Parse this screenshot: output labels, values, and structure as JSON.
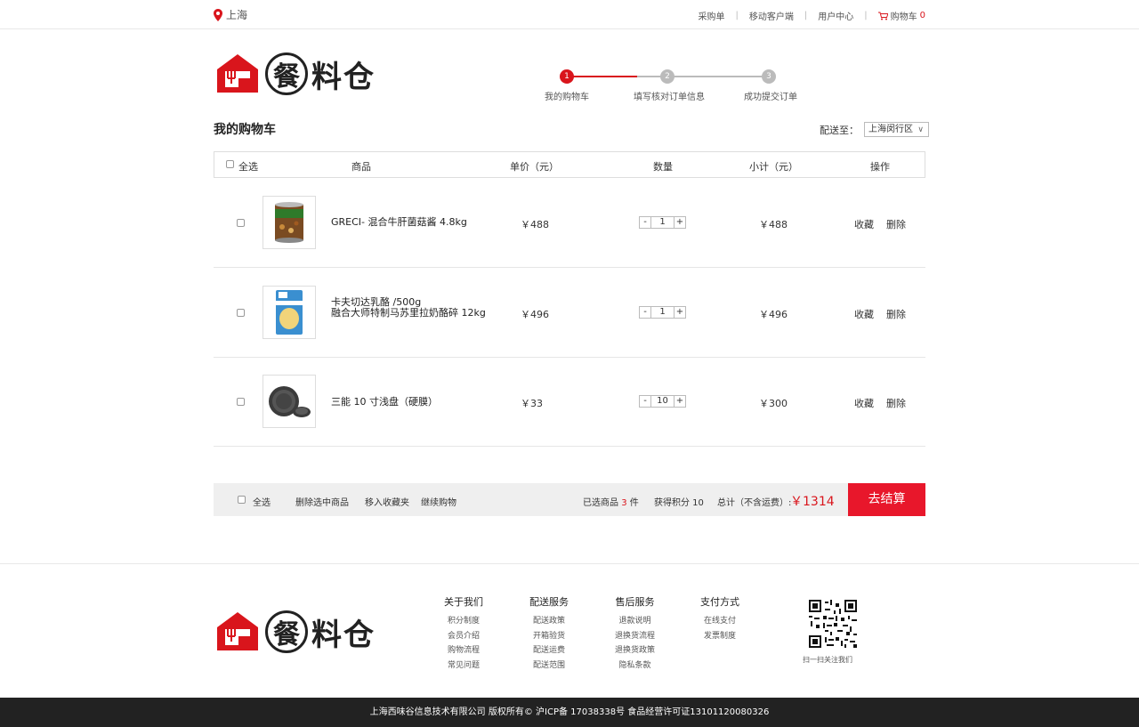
{
  "topbar": {
    "location": "上海",
    "links": [
      "采购单",
      "移动客户端",
      "用户中心"
    ],
    "cart_label": "购物车",
    "cart_count": "0"
  },
  "logo": {
    "char1": "餐",
    "rest": "料仓"
  },
  "steps": [
    {
      "num": "1",
      "label": "我的购物车"
    },
    {
      "num": "2",
      "label": "填写核对订单信息"
    },
    {
      "num": "3",
      "label": "成功提交订单"
    }
  ],
  "page_title": "我的购物车",
  "shipping": {
    "label": "配送至：",
    "value": "上海闵行区"
  },
  "table": {
    "headers": {
      "select_all": "全选",
      "product": "商品",
      "unit_price": "单价（元）",
      "quantity": "数量",
      "subtotal": "小计（元）",
      "actions": "操作"
    },
    "rows": [
      {
        "name1": "GRECI- 混合牛肝菌菇酱 4.8kg",
        "name2": "",
        "price": "￥488",
        "qty": "1",
        "subtotal": "￥488",
        "fav": "收藏",
        "del": "删除"
      },
      {
        "name1": "卡夫切达乳酪 /500g",
        "name2": "融合大师特制马苏里拉奶酪碎 12kg",
        "price": "￥496",
        "qty": "1",
        "subtotal": "￥496",
        "fav": "收藏",
        "del": "删除"
      },
      {
        "name1": "三能 10 寸浅盘（硬膜）",
        "name2": "",
        "price": "￥33",
        "qty": "10",
        "subtotal": "￥300",
        "fav": "收藏",
        "del": "删除"
      }
    ],
    "minus": "-",
    "plus": "+"
  },
  "summary": {
    "select_all": "全选",
    "delete_selected": "删除选中商品",
    "move_to_favorites": "移入收藏夹",
    "continue_shopping": "继续购物",
    "selected_prefix": "已选商品",
    "selected_count": "3",
    "selected_suffix": "件",
    "points": "获得积分 10",
    "total_label": "总计（不含运费）:",
    "total_value": "￥1314",
    "checkout": "去结算"
  },
  "footer": {
    "columns": [
      {
        "title": "关于我们",
        "items": [
          "积分制度",
          "会员介绍",
          "购物流程",
          "常见问题"
        ]
      },
      {
        "title": "配送服务",
        "items": [
          "配送政策",
          "开箱验货",
          "配送运费",
          "配送范围"
        ]
      },
      {
        "title": "售后服务",
        "items": [
          "退款说明",
          "退换货流程",
          "退换货政策",
          "隐私条款"
        ]
      },
      {
        "title": "支付方式",
        "items": [
          "在线支付",
          "发票制度"
        ]
      }
    ],
    "qr_label": "扫一扫关注我们",
    "copyright": "上海西味谷信息技术有限公司  版权所有© 沪ICP备 17038338号  食品经营许可证13101120080326"
  },
  "colors": {
    "accent": "#e8172b",
    "step_inactive": "#bbbbbb",
    "dark_footer": "#222222"
  }
}
